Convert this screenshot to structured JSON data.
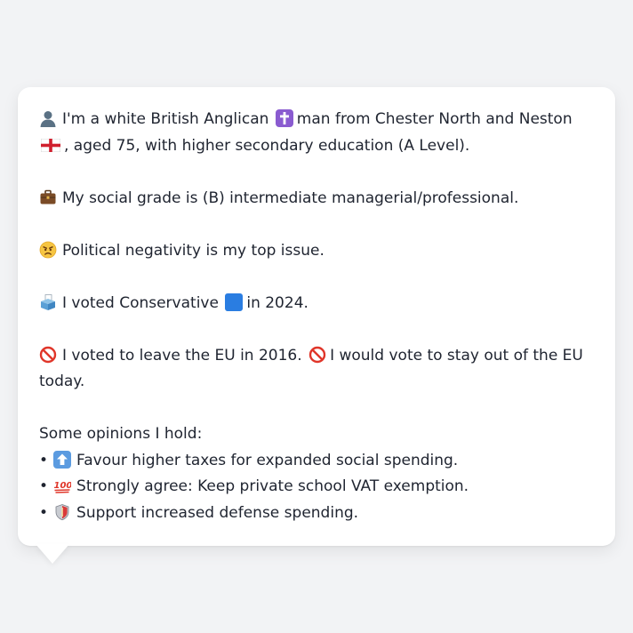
{
  "bio": {
    "intro_part1": "I'm a white British Anglican",
    "intro_part2": "man from Chester North and Neston",
    "intro_part3": ", aged 75, with higher secondary education (A Level).",
    "social_grade": "My social grade is (B) intermediate managerial/professional.",
    "top_issue": "Political negativity is my top issue.",
    "vote_part1": "I voted Conservative",
    "vote_part2": "in 2024.",
    "eu_part1": "I voted to leave the EU in 2016.",
    "eu_part2": "I would vote to stay out of the EU today.",
    "opinions_heading": "Some opinions I hold:"
  },
  "opinions": [
    {
      "bullet": "•",
      "icon": "up-arrow-icon",
      "text": "Favour higher taxes for expanded social spending."
    },
    {
      "bullet": "•",
      "icon": "hundred-points-icon",
      "text": "Strongly agree: Keep private school VAT exemption."
    },
    {
      "bullet": "•",
      "icon": "shield-icon",
      "text": "Support increased defense spending."
    }
  ],
  "icons": {
    "person": "person-silhouette-icon",
    "religion": "latin-cross-icon",
    "flag": "england-flag-icon",
    "work": "briefcase-icon",
    "issue": "angry-face-icon",
    "ballot": "ballot-box-icon",
    "party": "blue-square-icon",
    "prohibited": "prohibited-icon"
  },
  "colors": {
    "background": "#f2f3f5",
    "card": "#ffffff",
    "text": "#1f2430",
    "conservative_blue": "#2a7de1"
  }
}
